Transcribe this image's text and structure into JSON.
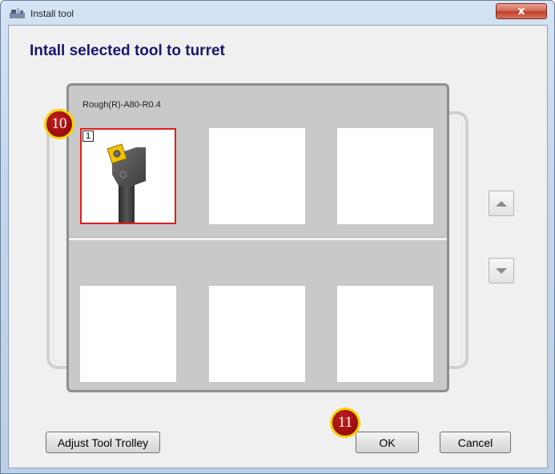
{
  "window": {
    "title": "Install tool",
    "close_glyph": "x"
  },
  "heading": "Intall selected tool to turret",
  "rack": {
    "selected_tool_name": "Rough(R)-A80-R0.4",
    "slots": [
      {
        "number": "1",
        "selected": true,
        "has_tool": true
      },
      {
        "number": "",
        "selected": false,
        "has_tool": false
      },
      {
        "number": "",
        "selected": false,
        "has_tool": false
      },
      {
        "number": "",
        "selected": false,
        "has_tool": false
      },
      {
        "number": "",
        "selected": false,
        "has_tool": false
      },
      {
        "number": "",
        "selected": false,
        "has_tool": false
      }
    ]
  },
  "scroll": {
    "up_icon": "triangle-up-icon",
    "down_icon": "triangle-down-icon"
  },
  "buttons": {
    "adjust_trolley": "Adjust Tool Trolley",
    "ok": "OK",
    "cancel": "Cancel"
  },
  "markers": {
    "rack_marker": "10",
    "ok_marker": "11"
  },
  "colors": {
    "heading": "#18186e",
    "selection_border": "#e01e1e",
    "marker_fill": "#9a0c0c",
    "marker_ring": "#f2d400",
    "insert_yellow": "#f2c200"
  }
}
